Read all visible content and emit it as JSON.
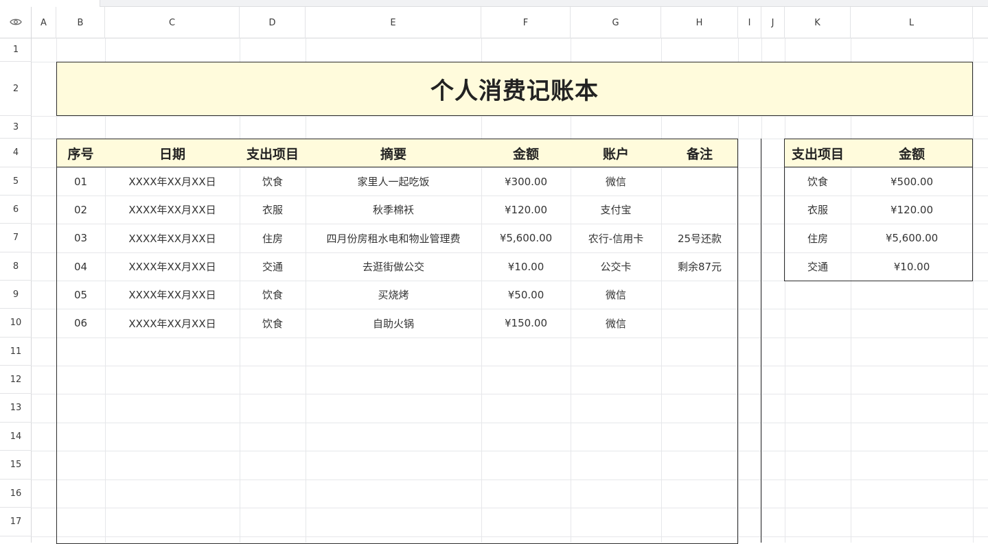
{
  "sheet": {
    "columns": [
      "A",
      "B",
      "C",
      "D",
      "E",
      "F",
      "G",
      "H",
      "I",
      "J",
      "K",
      "L"
    ],
    "rows": [
      "1",
      "2",
      "3",
      "4",
      "5",
      "6",
      "7",
      "8",
      "9",
      "10",
      "11",
      "12",
      "13",
      "14",
      "15",
      "16",
      "17"
    ]
  },
  "title": "个人消费记账本",
  "main_table": {
    "headers": [
      "序号",
      "日期",
      "支出项目",
      "摘要",
      "金额",
      "账户",
      "备注"
    ],
    "rows": [
      [
        "01",
        "XXXX年XX月XX日",
        "饮食",
        "家里人一起吃饭",
        "¥300.00",
        "微信",
        ""
      ],
      [
        "02",
        "XXXX年XX月XX日",
        "衣服",
        "秋季棉袄",
        "¥120.00",
        "支付宝",
        ""
      ],
      [
        "03",
        "XXXX年XX月XX日",
        "住房",
        "四月份房租水电和物业管理费",
        "¥5,600.00",
        "农行-信用卡",
        "25号还款"
      ],
      [
        "04",
        "XXXX年XX月XX日",
        "交通",
        "去逛街做公交",
        "¥10.00",
        "公交卡",
        "剩余87元"
      ],
      [
        "05",
        "XXXX年XX月XX日",
        "饮食",
        "买烧烤",
        "¥50.00",
        "微信",
        ""
      ],
      [
        "06",
        "XXXX年XX月XX日",
        "饮食",
        "自助火锅",
        "¥150.00",
        "微信",
        ""
      ]
    ]
  },
  "summary_table": {
    "headers": [
      "支出项目",
      "金额"
    ],
    "rows": [
      [
        "饮食",
        "¥500.00"
      ],
      [
        "衣服",
        "¥120.00"
      ],
      [
        "住房",
        "¥5,600.00"
      ],
      [
        "交通",
        "¥10.00"
      ]
    ]
  },
  "icons": {
    "corner": "eye-icon"
  },
  "colors": {
    "header_fill": "#fffbdc",
    "border": "#2b2b2b",
    "grid": "#e6e7ea"
  }
}
